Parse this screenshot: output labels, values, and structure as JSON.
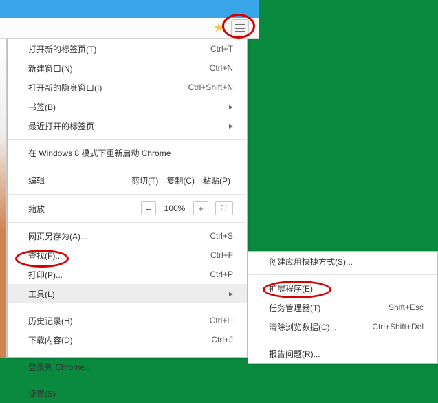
{
  "toolbar": {
    "star": "★"
  },
  "main_menu": {
    "items": [
      {
        "label": "打开新的标签页(T)",
        "sc": "Ctrl+T",
        "arrow": false
      },
      {
        "label": "新建窗口(N)",
        "sc": "Ctrl+N",
        "arrow": false
      },
      {
        "label": "打开新的隐身窗口(I)",
        "sc": "Ctrl+Shift+N",
        "arrow": false
      },
      {
        "label": "书签(B)",
        "sc": "",
        "arrow": true
      },
      {
        "label": "最近打开的标签页",
        "sc": "",
        "arrow": true
      }
    ],
    "win8": "在 Windows 8 模式下重新启动 Chrome",
    "edit": {
      "label": "编辑",
      "cut": "剪切(T)",
      "copy": "复制(C)",
      "paste": "粘贴(P)"
    },
    "zoom": {
      "label": "缩放",
      "minus": "–",
      "value": "100%",
      "plus": "+",
      "fs": "⛶"
    },
    "items2": [
      {
        "label": "网页另存为(A)...",
        "sc": "Ctrl+S",
        "arrow": false
      },
      {
        "label": "查找(F)...",
        "sc": "Ctrl+F",
        "arrow": false
      },
      {
        "label": "打印(P)...",
        "sc": "Ctrl+P",
        "arrow": false
      },
      {
        "label": "工具(L)",
        "sc": "",
        "arrow": true,
        "hover": true
      }
    ],
    "items3": [
      {
        "label": "历史记录(H)",
        "sc": "Ctrl+H",
        "arrow": false
      },
      {
        "label": "下载内容(D)",
        "sc": "Ctrl+J",
        "arrow": false
      }
    ],
    "items4": [
      {
        "label": "登录到 Chrome...",
        "sc": "",
        "arrow": false
      }
    ],
    "items5": [
      {
        "label": "设置(S)",
        "sc": "",
        "arrow": false
      }
    ]
  },
  "sub_menu": {
    "items1": [
      {
        "label": "创建应用快捷方式(S)...",
        "sc": "",
        "arrow": false
      }
    ],
    "items2": [
      {
        "label": "扩展程序(E)",
        "sc": "",
        "arrow": false
      },
      {
        "label": "任务管理器(T)",
        "sc": "Shift+Esc",
        "arrow": false
      },
      {
        "label": "清除浏览数据(C)...",
        "sc": "Ctrl+Shift+Del",
        "arrow": false
      }
    ],
    "items3": [
      {
        "label": "报告问题(R)...",
        "sc": "",
        "arrow": false
      }
    ]
  }
}
